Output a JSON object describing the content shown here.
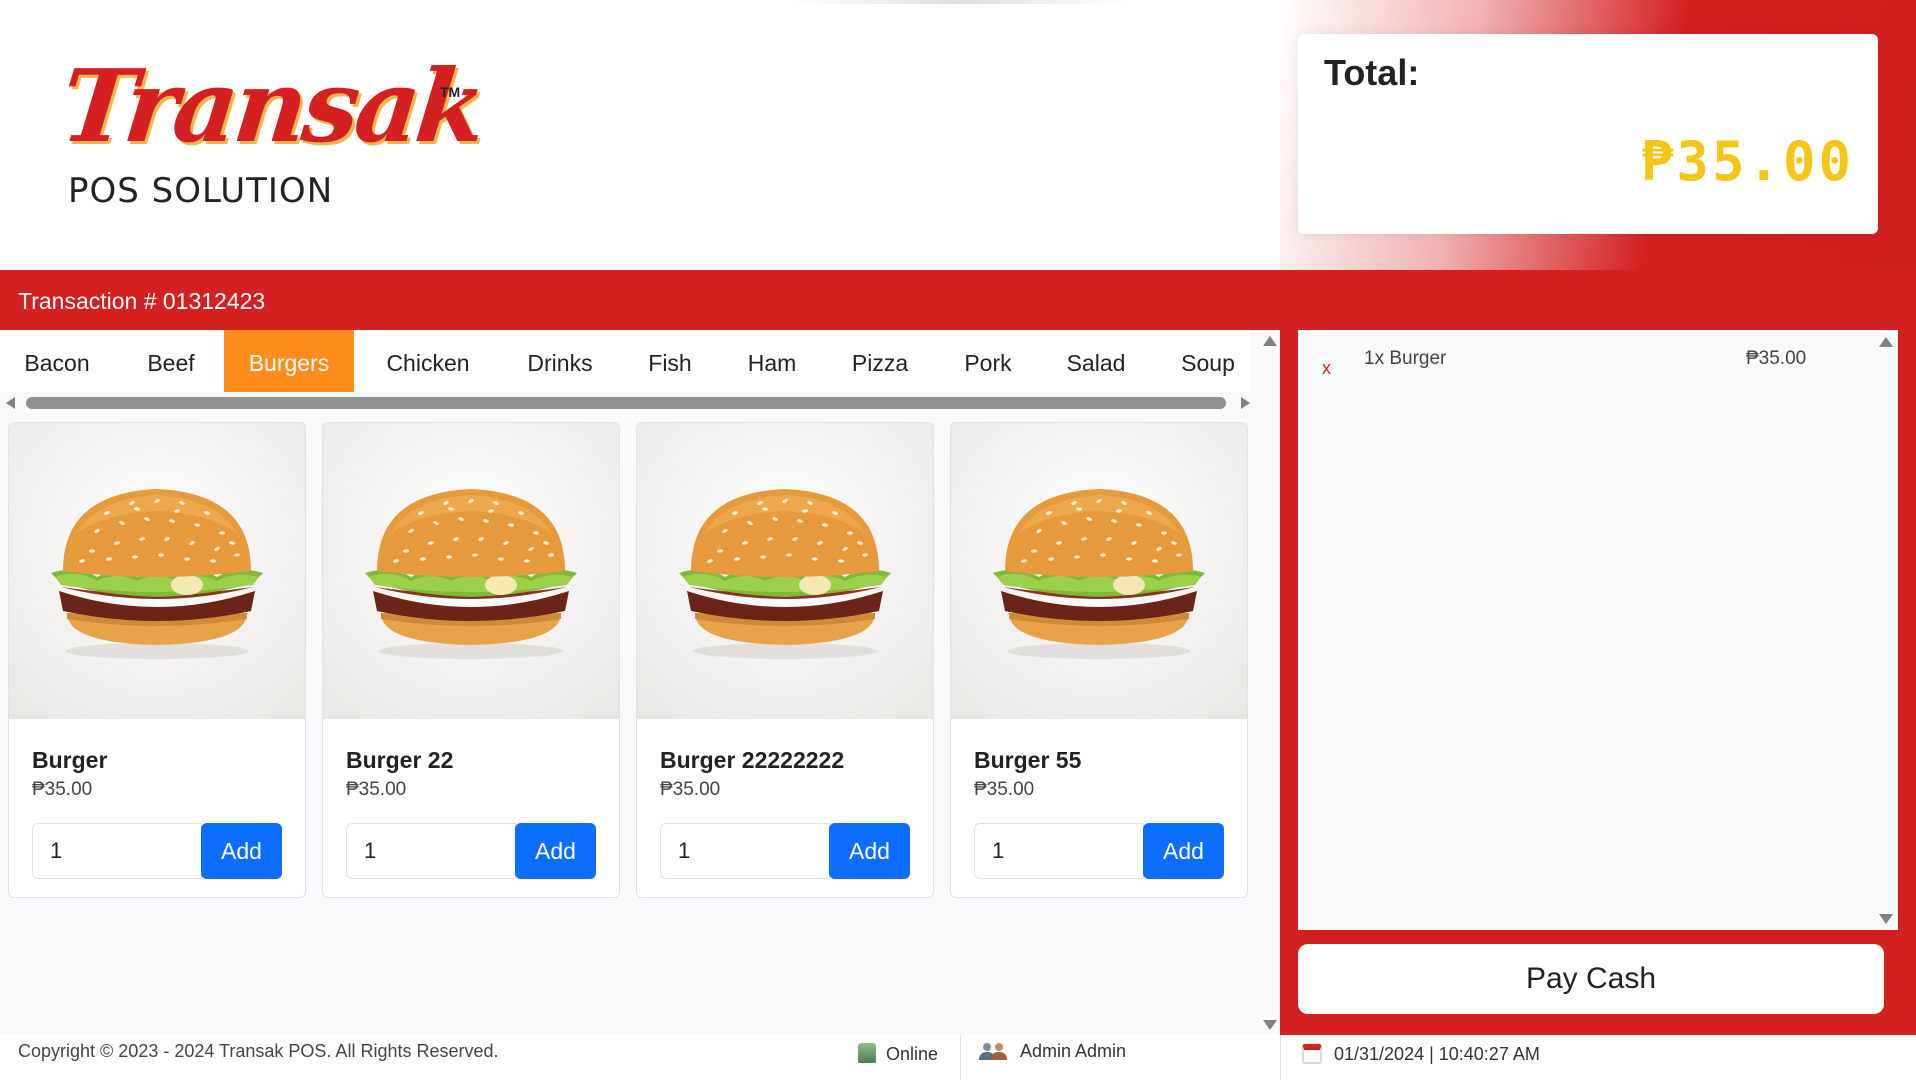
{
  "brand": {
    "logo_word": "Transak",
    "logo_tm": "TM",
    "logo_sub": "POS SOLUTION"
  },
  "total": {
    "label": "Total:",
    "value": "₱35.00"
  },
  "transaction": {
    "text": "Transaction # 01312423"
  },
  "categories": [
    {
      "label": "Bacon"
    },
    {
      "label": "Beef"
    },
    {
      "label": "Burgers",
      "active": true
    },
    {
      "label": "Chicken"
    },
    {
      "label": "Drinks"
    },
    {
      "label": "Fish"
    },
    {
      "label": "Ham"
    },
    {
      "label": "Pizza"
    },
    {
      "label": "Pork"
    },
    {
      "label": "Salad"
    },
    {
      "label": "Soup"
    }
  ],
  "products": [
    {
      "name": "Burger",
      "price": "₱35.00",
      "qty": "1",
      "add_label": "Add"
    },
    {
      "name": "Burger 22",
      "price": "₱35.00",
      "qty": "1",
      "add_label": "Add"
    },
    {
      "name": "Burger 22222222",
      "price": "₱35.00",
      "qty": "1",
      "add_label": "Add"
    },
    {
      "name": "Burger 55",
      "price": "₱35.00",
      "qty": "1",
      "add_label": "Add"
    }
  ],
  "cart": {
    "items": [
      {
        "remove": "x",
        "name": "1x Burger",
        "price": "₱35.00"
      }
    ],
    "pay_label": "Pay Cash"
  },
  "footer": {
    "copyright": "Copyright © 2023 - 2024 Transak POS. All Rights Reserved.",
    "status": "Online",
    "user": "Admin Admin",
    "datetime": "01/31/2024 | 10:40:27 AM"
  },
  "colors": {
    "brand_red": "#d42020",
    "active_tab": "#fd8c1a",
    "primary_button": "#0d6efd",
    "total_value": "#f5c518"
  },
  "icons": [
    "close-x-icon",
    "database-online-icon",
    "users-icon",
    "calendar-icon",
    "burger-image"
  ]
}
